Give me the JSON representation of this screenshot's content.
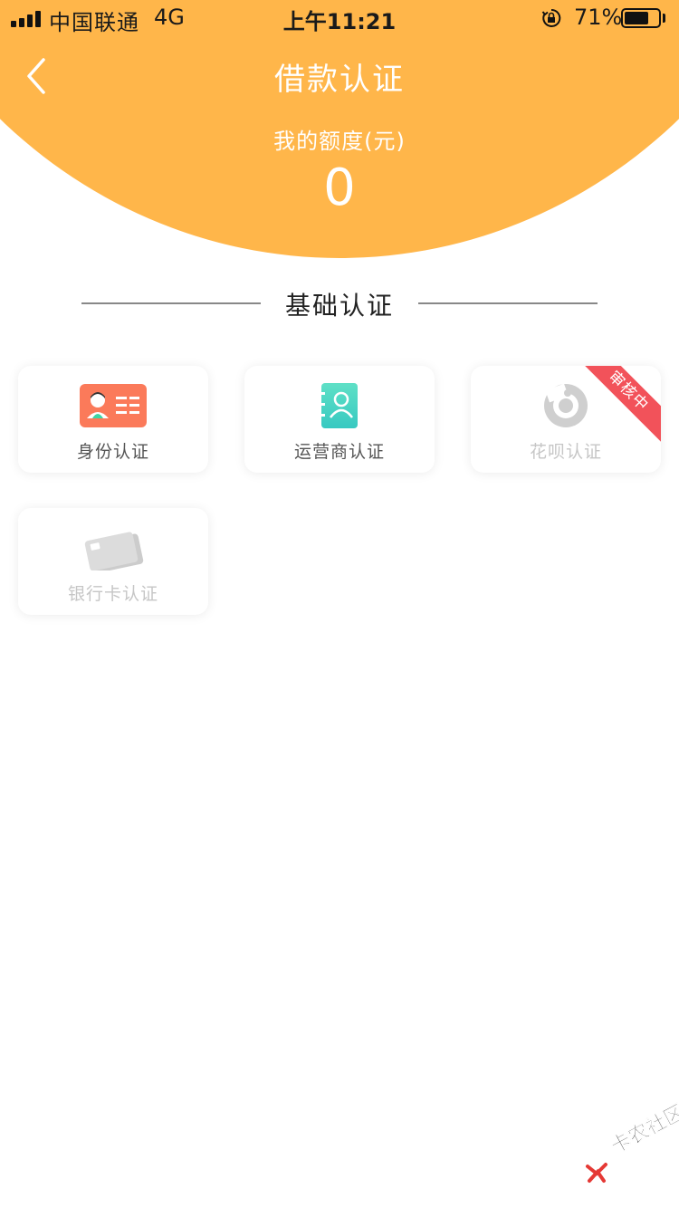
{
  "status_bar": {
    "carrier": "中国联通",
    "network": "4G",
    "time": "上午11:21",
    "battery_percent": "71%",
    "battery_level": 0.71
  },
  "header": {
    "title": "借款认证",
    "quota_label": "我的额度(元)",
    "quota_value": "0",
    "background_color": "#ffb64a"
  },
  "section": {
    "title": "基础认证"
  },
  "cards": [
    {
      "label": "身份认证",
      "icon": "id-card-icon",
      "enabled": true
    },
    {
      "label": "运营商认证",
      "icon": "contact-book-icon",
      "enabled": true
    },
    {
      "label": "花呗认证",
      "icon": "huabei-icon",
      "enabled": false,
      "badge": "审核中"
    },
    {
      "label": "银行卡认证",
      "icon": "bank-card-icon",
      "enabled": false
    }
  ],
  "watermark": {
    "text": "卡农社区"
  },
  "colors": {
    "accent": "#ffb64a",
    "badge": "#f2525a",
    "id_icon": "#fb7a5a",
    "contact_icon": "#3ed6c4"
  }
}
